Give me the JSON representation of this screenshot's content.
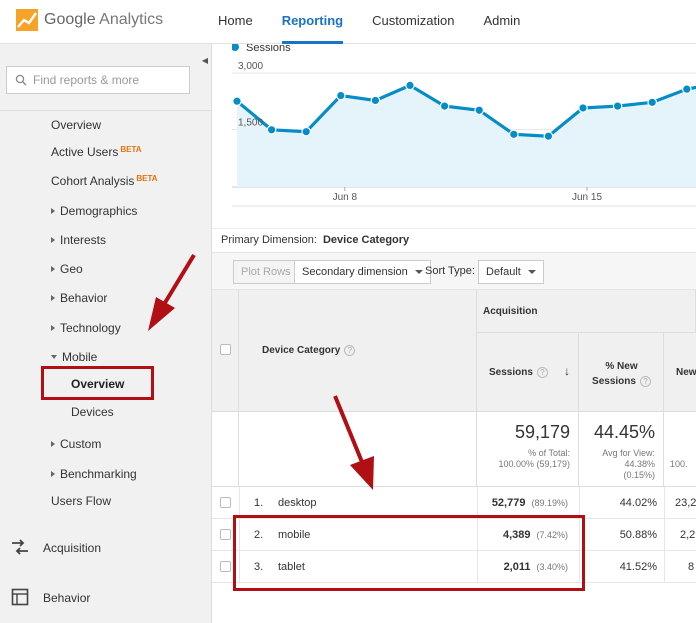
{
  "header": {
    "logo_brand": "Google",
    "logo_product": "Analytics",
    "nav": [
      "Home",
      "Reporting",
      "Customization",
      "Admin"
    ],
    "active_nav": "Reporting"
  },
  "sidebar": {
    "search_placeholder": "Find reports & more",
    "items": {
      "overview": "Overview",
      "active_users": "Active Users",
      "cohort": "Cohort Analysis",
      "beta": "BETA",
      "demographics": "Demographics",
      "interests": "Interests",
      "geo": "Geo",
      "behavior": "Behavior",
      "technology": "Technology",
      "mobile": "Mobile",
      "mobile_overview": "Overview",
      "devices": "Devices",
      "custom": "Custom",
      "benchmarking": "Benchmarking",
      "users_flow": "Users Flow"
    },
    "sections": {
      "acquisition": "Acquisition",
      "behavior": "Behavior"
    }
  },
  "chart_data": {
    "type": "line",
    "legend": "Sessions",
    "yticks": [
      "3,000",
      "1,500"
    ],
    "ylim": [
      0,
      3800
    ],
    "xticks": [
      {
        "label": "Jun 8",
        "index": 3
      },
      {
        "label": "Jun 15",
        "index": 10
      }
    ],
    "values": [
      2280,
      1520,
      1470,
      2430,
      2300,
      2700,
      2150,
      2040,
      1400,
      1350,
      2100,
      2150,
      2250,
      2600,
      2780
    ],
    "colors": {
      "line": "#058dc7",
      "fill": "#e5f3fa"
    }
  },
  "dimension": {
    "label": "Primary Dimension:",
    "value": "Device Category"
  },
  "toolbar": {
    "plot_rows": "Plot Rows",
    "secondary": "Secondary dimension",
    "sort_label": "Sort Type:",
    "sort_value": "Default"
  },
  "table": {
    "group_header": "Acquisition",
    "col_device": "Device Category",
    "col_sessions": "Sessions",
    "col_new1": "% New",
    "col_new2": "Sessions",
    "col_next": "New",
    "help": "?",
    "sort_arrow": "↓",
    "totals": {
      "sessions": "59,179",
      "sessions_sub1": "% of Total:",
      "sessions_sub2": "100.00% (59,179)",
      "new_pct": "44.45%",
      "new_sub1": "Avg for View:",
      "new_sub2": "44.38%",
      "new_sub3": "(0.15%)",
      "next_sub": "100."
    },
    "rows": [
      {
        "idx": "1.",
        "device": "desktop",
        "sessions": "52,779",
        "pct": "(89.19%)",
        "new": "44.02%",
        "next": "23,2"
      },
      {
        "idx": "2.",
        "device": "mobile",
        "sessions": "4,389",
        "pct": "(7.42%)",
        "new": "50.88%",
        "next": "2,2"
      },
      {
        "idx": "3.",
        "device": "tablet",
        "sessions": "2,011",
        "pct": "(3.40%)",
        "new": "41.52%",
        "next": "8"
      }
    ]
  }
}
